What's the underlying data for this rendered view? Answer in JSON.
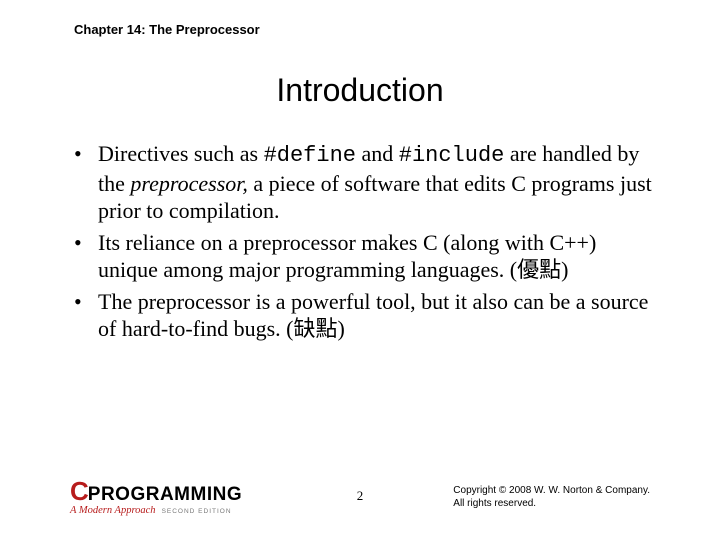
{
  "header": {
    "chapter": "Chapter 14: The Preprocessor"
  },
  "title": "Introduction",
  "bullets": [
    {
      "pre": "Directives such as ",
      "code1": "#define",
      "mid1": " and ",
      "code2": "#include",
      "mid2": " are handled by the ",
      "em": "preprocessor,",
      "post": " a piece of software that edits C programs just prior to compilation."
    },
    {
      "pre": "Its reliance on a preprocessor makes C (along with C++) unique among major programming languages. (",
      "cjk": "優點",
      "post": ")"
    },
    {
      "pre": "The preprocessor is a powerful tool, but it also can be a source of hard-to-find bugs. (",
      "cjk": "缺點",
      "post": ")"
    }
  ],
  "footer": {
    "logo_c": "C",
    "logo_text": "PROGRAMMING",
    "logo_sub": "A Modern Approach",
    "logo_edition": "SECOND EDITION",
    "page": "2",
    "copyright_line1": "Copyright © 2008 W. W. Norton & Company.",
    "copyright_line2": "All rights reserved."
  }
}
